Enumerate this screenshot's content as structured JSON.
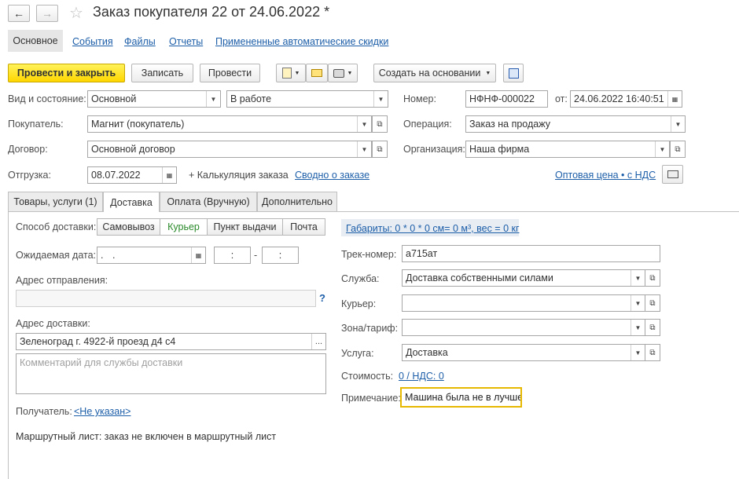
{
  "window": {
    "title": "Заказ покупателя 22 от 24.06.2022 *"
  },
  "nav_tabs": [
    {
      "label": "Основное",
      "active": true
    },
    {
      "label": "События"
    },
    {
      "label": "Файлы"
    },
    {
      "label": "Отчеты"
    },
    {
      "label": "Примененные автоматические скидки"
    }
  ],
  "toolbar": {
    "post_close": "Провести и закрыть",
    "save": "Записать",
    "post": "Провести",
    "create_based": "Создать на основании"
  },
  "header": {
    "state_label": "Вид и состояние:",
    "state_type": "Основной",
    "state_status": "В работе",
    "number_label": "Номер:",
    "number": "НФНФ-000022",
    "date_from_label": "от:",
    "date": "24.06.2022 16:40:51",
    "customer_label": "Покупатель:",
    "customer": "Магнит (покупатель)",
    "operation_label": "Операция:",
    "operation": "Заказ на продажу",
    "contract_label": "Договор:",
    "contract": "Основной договор",
    "organization_label": "Организация:",
    "organization": "Наша фирма",
    "shipment_label": "Отгрузка:",
    "shipment_date": "08.07.2022",
    "calc_link": "+ Калькуляция заказа",
    "summary_link": "Сводно о заказе",
    "price_link": "Оптовая цена • с НДС"
  },
  "doc_tabs": [
    {
      "label": "Товары, услуги (1)"
    },
    {
      "label": "Доставка",
      "active": true
    },
    {
      "label": "Оплата (Вручную)"
    },
    {
      "label": "Дополнительно"
    }
  ],
  "delivery": {
    "method_label": "Способ доставки:",
    "methods": [
      "Самовывоз",
      "Курьер",
      "Пункт выдачи",
      "Почта"
    ],
    "active_method": "Курьер",
    "dimensions_link": "Габариты: 0 * 0 * 0 см= 0 м³, вес = 0 кг",
    "expected_date_label": "Ожидаемая дата:",
    "expected_date": " .  .",
    "time_from": " :",
    "time_sep": "-",
    "time_to": " :",
    "send_address_label": "Адрес отправления:",
    "send_address": "",
    "help": "?",
    "delivery_address_label": "Адрес доставки:",
    "delivery_address": "Зеленоград г. 4922-й проезд д4 с4",
    "ellipsis": "...",
    "comment_placeholder": "Комментарий для службы доставки",
    "recipient_label": "Получатель:",
    "recipient_link": "<Не указан>",
    "route_text": "Маршрутный лист: заказ не включен в маршрутный лист",
    "track_label": "Трек-номер:",
    "track": "а715ат",
    "service_label": "Служба:",
    "service": "Доставка собственными силами",
    "courier_label": "Курьер:",
    "courier": "",
    "zone_label": "Зона/тариф:",
    "zone": "",
    "svc_label": "Услуга:",
    "svc": "Доставка",
    "cost_label": "Стоимость:",
    "cost_link": "0 / НДС: 0",
    "note_label": "Примечание:",
    "note": "Машина была не в лучше"
  },
  "colors": {
    "primary_button": "#ffd600",
    "link": "#1c5ea8",
    "active_method": "#2a8a2a",
    "focus_border": "#e6b800"
  }
}
